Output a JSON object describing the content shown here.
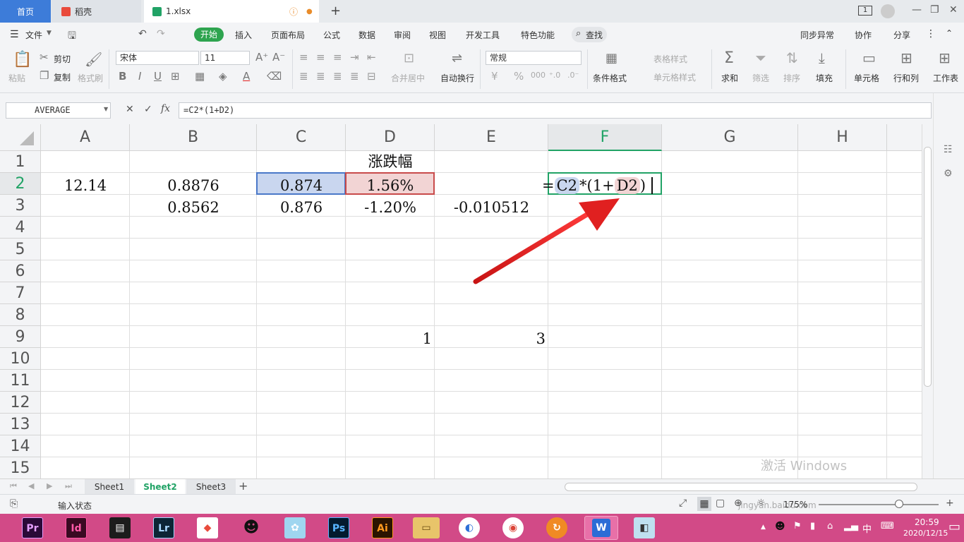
{
  "tabs": {
    "home": "首页",
    "daoke": "稻壳",
    "file": "1.xlsx",
    "new": "+"
  },
  "window": {
    "badge": "1",
    "min": "—",
    "restore": "❐",
    "close": "✕"
  },
  "menu": {
    "file": "文件",
    "start": "开始",
    "insert": "插入",
    "page_layout": "页面布局",
    "formula": "公式",
    "data": "数据",
    "review": "审阅",
    "view": "视图",
    "dev_tools": "开发工具",
    "special": "特色功能",
    "search": "查找",
    "sync": "同步异常",
    "collab": "协作",
    "share": "分享"
  },
  "ribbon": {
    "paste": "粘贴",
    "cut": "剪切",
    "copy": "复制",
    "format_painter": "格式刷",
    "font_name": "宋体",
    "font_size": "11",
    "merge_center": "合并居中",
    "wrap_text": "自动换行",
    "number_format": "常规",
    "conditional_format": "条件格式",
    "table_style": "表格样式",
    "cell_style": "单元格样式",
    "sum": "求和",
    "filter": "筛选",
    "sort": "排序",
    "fill": "填充",
    "cells": "单元格",
    "rows_cols": "行和列",
    "worksheet": "工作表"
  },
  "formula_bar": {
    "name_box": "AVERAGE",
    "cancel": "✕",
    "confirm": "✓",
    "fx": "fx",
    "formula": "=C2*(1+D2)"
  },
  "columns": [
    "A",
    "B",
    "C",
    "D",
    "E",
    "F",
    "G",
    "H"
  ],
  "rows": [
    "1",
    "2",
    "3",
    "4",
    "5",
    "6",
    "7",
    "8",
    "9",
    "10",
    "11",
    "12",
    "13",
    "14",
    "15"
  ],
  "cells": {
    "D1": "涨跌幅",
    "A2": "12.14",
    "B2": "0.8876",
    "C2": "0.874",
    "D2": "1.56%",
    "B3": "0.8562",
    "C3": "0.876",
    "D3": "-1.20%",
    "E3": "-0.010512",
    "D9": "1",
    "E9": "3",
    "F2_eq": "=",
    "F2_ref1": "C2",
    "F2_mid": "*(1+",
    "F2_ref2": "D2",
    "F2_end": ")"
  },
  "sheets": [
    "Sheet1",
    "Sheet2",
    "Sheet3"
  ],
  "status": {
    "mode": "输入状态",
    "zoom": "175%"
  },
  "taskbar": {
    "pr": "Pr",
    "id": "Id",
    "lr": "Lr",
    "ps": "Ps",
    "ai": "Ai",
    "time": "20:59",
    "date": "2020/12/15",
    "lang": "中"
  },
  "watermark": {
    "activate": "激活 Windows",
    "site": "jingyan.baidu.com"
  },
  "colors": {
    "accent_green": "#21a366",
    "ref_blue": "#c9d6ef",
    "ref_red": "#f2d4d4",
    "arrow_red": "#e02020",
    "taskbar": "#d24a87"
  }
}
